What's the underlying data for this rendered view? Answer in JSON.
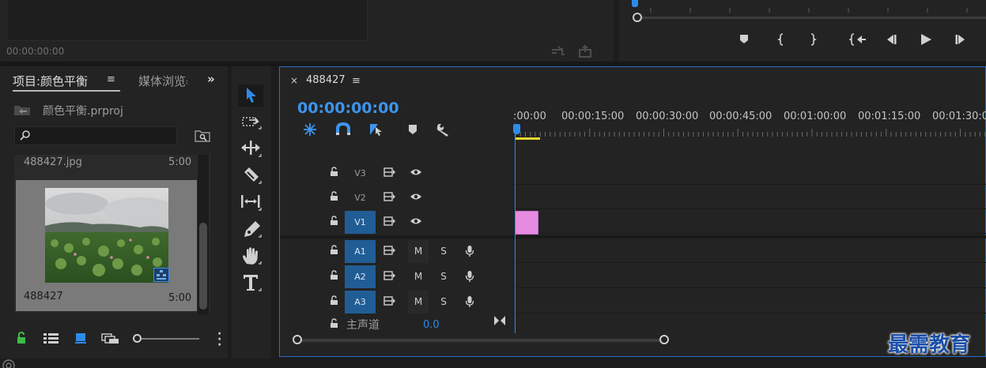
{
  "source_monitor": {
    "timecode": "00:00:00:00"
  },
  "program_monitor": {
    "buttons": [
      "marker-icon",
      "mark-in-icon",
      "mark-out-icon",
      "go-to-in-icon",
      "step-back-icon",
      "play-icon",
      "step-forward-icon"
    ]
  },
  "project": {
    "tab_label": "项目:颜色平衡",
    "menu_glyph": "≡",
    "media_tab_label": "媒体浏览器",
    "overflow_glyph": "»",
    "file_name": "颜色平衡.prproj",
    "search_placeholder": "",
    "items": [
      {
        "name": "488427.jpg",
        "duration": "5:00"
      },
      {
        "name": "488427",
        "duration": "5:00"
      }
    ]
  },
  "timeline": {
    "close_glyph": "×",
    "sequence_name": "488427",
    "menu_glyph": "≡",
    "timecode": "00:00:00:00",
    "ruler_labels": [
      ":00:00",
      "00:00:15:00",
      "00:00:30:00",
      "00:00:45:00",
      "00:01:00:00",
      "00:01:15:00",
      "00:01:30:00"
    ],
    "video_tracks": [
      {
        "label": "V3",
        "targeted": false
      },
      {
        "label": "V2",
        "targeted": false
      },
      {
        "label": "V1",
        "targeted": true
      }
    ],
    "audio_tracks": [
      {
        "label": "A1",
        "m": "M",
        "s": "S"
      },
      {
        "label": "A2",
        "m": "M",
        "s": "S"
      },
      {
        "label": "A3",
        "m": "M",
        "s": "S"
      }
    ],
    "master_label": "主声道",
    "master_value": "0.0"
  },
  "colors": {
    "accent": "#2d8ceb",
    "clip": "#e58be2",
    "track_target": "#215d95",
    "workarea": "#e9d82e"
  },
  "watermark": "最需教育"
}
